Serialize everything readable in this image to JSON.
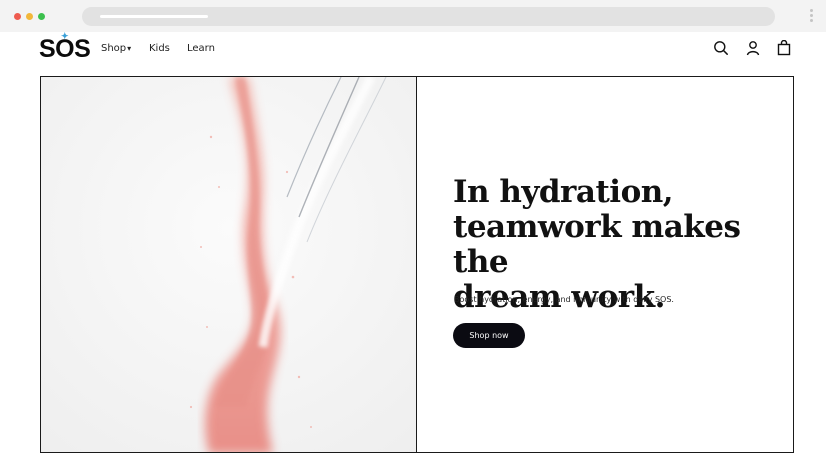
{
  "brand": {
    "logo_text": "SOS",
    "accent_color": "#3aa0d8"
  },
  "nav": {
    "shop_label": "Shop",
    "kids_label": "Kids",
    "learn_label": "Learn"
  },
  "header_icons": [
    "search-icon",
    "account-icon",
    "shopping-bag-icon"
  ],
  "hero": {
    "headline_lines": [
      "In hydration,",
      "teamwork makes the",
      "dream work."
    ],
    "subtext": "Boost hydration, energy, and immunity with daily SOS.",
    "cta_label": "Shop now"
  }
}
